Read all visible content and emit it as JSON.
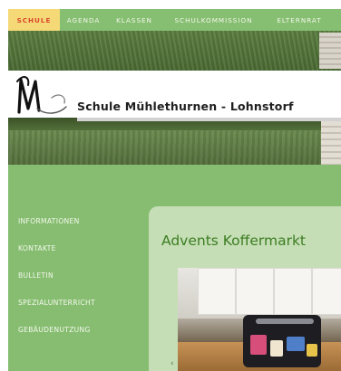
{
  "nav": {
    "items": [
      {
        "label": "SCHULE",
        "active": true
      },
      {
        "label": "AGENDA",
        "active": false
      },
      {
        "label": "KLASSEN",
        "active": false
      },
      {
        "label": "SCHULKOMMISSION",
        "active": false
      },
      {
        "label": "ELTERNRAT",
        "active": false
      }
    ]
  },
  "header": {
    "school_name": "Schule Mühlethurnen - Lohnstorf"
  },
  "sidebar": {
    "items": [
      {
        "label": "INFORMATIONEN"
      },
      {
        "label": "KONTAKTE"
      },
      {
        "label": "BULLETIN"
      },
      {
        "label": "SPEZIALUNTERRICHT"
      },
      {
        "label": "GEBÄUDENUTZUNG"
      }
    ]
  },
  "content": {
    "title": "Advents Koffermarkt",
    "prev_arrow": "‹"
  },
  "colors": {
    "nav_bg": "#87bf72",
    "nav_active_bg": "#f5d977",
    "nav_active_text": "#d9452c",
    "page_bg": "#86bd70",
    "card_bg": "#c5deb6",
    "title_text": "#3c7d22"
  }
}
